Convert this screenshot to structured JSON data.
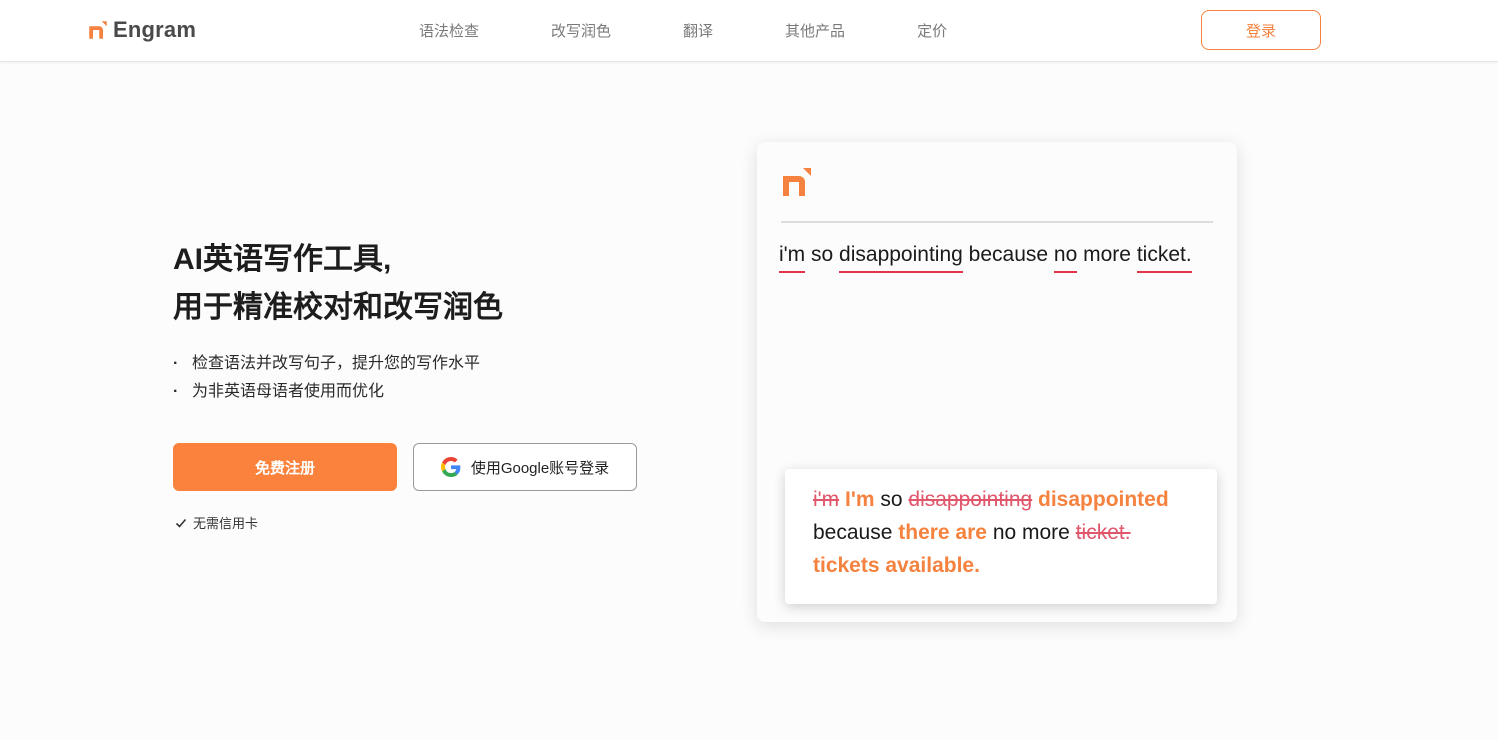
{
  "header": {
    "brand": "Engram",
    "nav": [
      "语法检查",
      "改写润色",
      "翻译",
      "其他产品",
      "定价"
    ],
    "login_label": "登录"
  },
  "hero": {
    "title_line1": "AI英语写作工具,",
    "title_line2": "用于精准校对和改写润色",
    "features": [
      "检查语法并改写句子，提升您的写作水平",
      "为非英语母语者使用而优化"
    ],
    "signup_label": "免费注册",
    "google_label": "使用Google账号登录",
    "no_card_label": "无需信用卡"
  },
  "demo": {
    "original": {
      "w1": "i'm",
      "w2": "so",
      "w3": "disappointing",
      "w4": "because",
      "w5": "no",
      "w6": "more",
      "w7": "ticket."
    },
    "corrected": {
      "del1": "i'm",
      "ins1": "I'm",
      "t1": "so",
      "del2": "disappointing",
      "ins2": "disappointed",
      "t2": "because",
      "ins3": "there are",
      "t3": "no more",
      "del3": "ticket.",
      "ins4": "tickets available."
    }
  },
  "colors": {
    "accent": "#fa823c",
    "error_underline": "#e5344a",
    "deleted_text": "#e0566b",
    "nav_text": "#7a7a7a"
  },
  "icons": {
    "logo": "engram-n-icon",
    "google": "google-g-icon",
    "check": "check-icon"
  }
}
